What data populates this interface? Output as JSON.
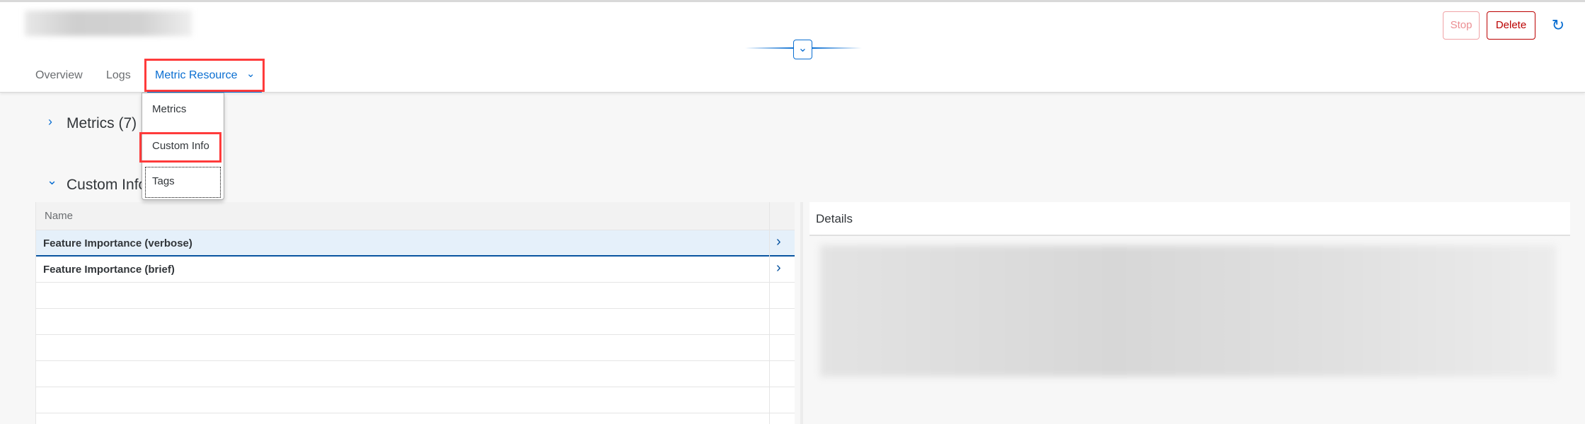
{
  "header": {
    "actions": {
      "stop": "Stop",
      "delete": "Delete"
    },
    "icons": {
      "refresh": "refresh-icon",
      "collapse": "chevron-down-icon"
    }
  },
  "tabs": [
    {
      "label": "Overview"
    },
    {
      "label": "Logs"
    },
    {
      "label": "Metric Resource",
      "active": true
    }
  ],
  "menu": {
    "items": [
      {
        "label": "Metrics"
      },
      {
        "label": "Custom Info"
      },
      {
        "label": "Tags"
      }
    ]
  },
  "sections": {
    "metrics": "Metrics (7)",
    "custom_info": "Custom Info"
  },
  "table": {
    "header": "Name",
    "rows": [
      {
        "name": "Feature Importance (verbose)",
        "selected": true
      },
      {
        "name": "Feature Importance (brief)"
      }
    ]
  },
  "details": {
    "title": "Details"
  },
  "colors": {
    "accent": "#0a6ed1",
    "delete": "#bb0000",
    "highlight": "#ff3b3b",
    "selected_row": "#e5f0fa"
  }
}
